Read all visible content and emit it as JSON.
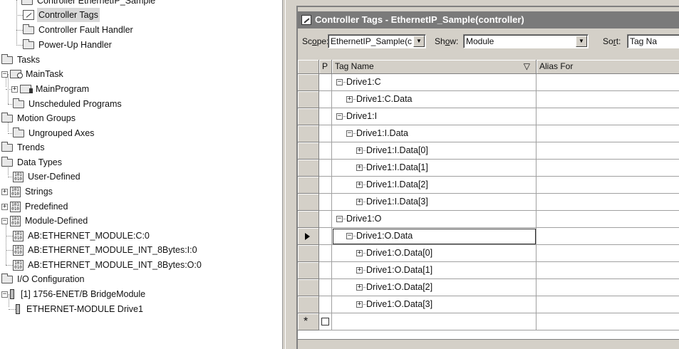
{
  "tree": {
    "items": [
      {
        "label": "Controller EthernetIP_Sample",
        "icon": "folder"
      },
      {
        "label": "Controller Tags",
        "icon": "tags",
        "selected": true
      },
      {
        "label": "Controller Fault Handler",
        "icon": "folder"
      },
      {
        "label": "Power-Up Handler",
        "icon": "folder"
      },
      {
        "label": "Tasks",
        "icon": "folder"
      },
      {
        "label": "MainTask",
        "icon": "task",
        "expander": "−"
      },
      {
        "label": "MainProgram",
        "icon": "program",
        "expander": "+"
      },
      {
        "label": "Unscheduled Programs",
        "icon": "folder"
      },
      {
        "label": "Motion Groups",
        "icon": "folder"
      },
      {
        "label": "Ungrouped Axes",
        "icon": "folder"
      },
      {
        "label": "Trends",
        "icon": "folder"
      },
      {
        "label": "Data Types",
        "icon": "folder"
      },
      {
        "label": "User-Defined",
        "icon": "datatype"
      },
      {
        "label": "Strings",
        "icon": "datatype",
        "expander": "+"
      },
      {
        "label": "Predefined",
        "icon": "datatype",
        "expander": "+"
      },
      {
        "label": "Module-Defined",
        "icon": "datatype",
        "expander": "−"
      },
      {
        "label": "AB:ETHERNET_MODULE:C:0",
        "icon": "datatype"
      },
      {
        "label": "AB:ETHERNET_MODULE_INT_8Bytes:I:0",
        "icon": "datatype"
      },
      {
        "label": "AB:ETHERNET_MODULE_INT_8Bytes:O:0",
        "icon": "datatype"
      },
      {
        "label": "I/O Configuration",
        "icon": "folder"
      },
      {
        "label": "[1] 1756-ENET/B BridgeModule",
        "icon": "module",
        "expander": "−"
      },
      {
        "label": "ETHERNET-MODULE Drive1",
        "icon": "module"
      }
    ]
  },
  "window": {
    "title": "Controller Tags - EthernetIP_Sample(controller)"
  },
  "toolbar": {
    "scope_label_pre": "Sc",
    "scope_label_ul": "o",
    "scope_label_post": "pe:",
    "scope_value": "EthernetIP_Sample(c",
    "show_label_pre": "Sh",
    "show_label_ul": "o",
    "show_label_post": "w:",
    "show_value": "Module",
    "sort_label_pre": "So",
    "sort_label_ul": "r",
    "sort_label_post": "t:",
    "sort_value": "Tag Na"
  },
  "grid": {
    "columns": {
      "p": "P",
      "name": "Tag Name",
      "sort_glyph": "▽",
      "alias": "Alias For"
    },
    "rows": [
      {
        "name": "Drive1:C",
        "level": 0,
        "expander": "−"
      },
      {
        "name": "Drive1:C.Data",
        "level": 1,
        "expander": "+"
      },
      {
        "name": "Drive1:I",
        "level": 0,
        "expander": "−"
      },
      {
        "name": "Drive1:I.Data",
        "level": 1,
        "expander": "−"
      },
      {
        "name": "Drive1:I.Data[0]",
        "level": 2,
        "expander": "+"
      },
      {
        "name": "Drive1:I.Data[1]",
        "level": 2,
        "expander": "+"
      },
      {
        "name": "Drive1:I.Data[2]",
        "level": 2,
        "expander": "+"
      },
      {
        "name": "Drive1:I.Data[3]",
        "level": 2,
        "expander": "+"
      },
      {
        "name": "Drive1:O",
        "level": 0,
        "expander": "−"
      },
      {
        "name": "Drive1:O.Data",
        "level": 1,
        "expander": "−",
        "current": true
      },
      {
        "name": "Drive1:O.Data[0]",
        "level": 2,
        "expander": "+"
      },
      {
        "name": "Drive1:O.Data[1]",
        "level": 2,
        "expander": "+"
      },
      {
        "name": "Drive1:O.Data[2]",
        "level": 2,
        "expander": "+"
      },
      {
        "name": "Drive1:O.Data[3]",
        "level": 2,
        "expander": "+"
      }
    ],
    "new_row_marker": "*"
  }
}
